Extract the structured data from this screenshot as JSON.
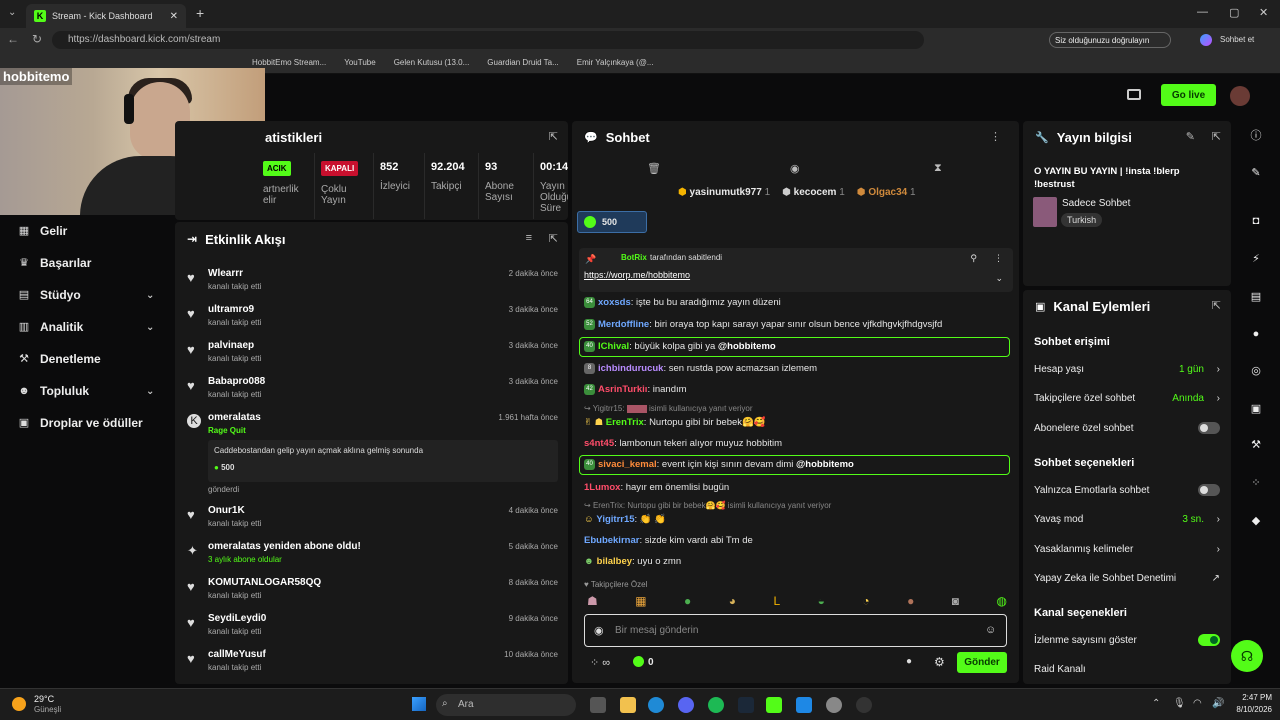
{
  "browser": {
    "tab_title": "Stream - Kick Dashboard",
    "url": "https://dashboard.kick.com/stream",
    "signin_notice": "Siz olduğunuzu doğrulayın",
    "copilot_label": "Sohbet et",
    "bookmarks": [
      "HobbitEmo Stream...",
      "YouTube",
      "Gelen Kutusu (13.0...",
      "Guardian Druid Ta...",
      "Emir Yalçınkaya (@..."
    ]
  },
  "webcam": {
    "overlay_text": "hobbitemo"
  },
  "topbar": {
    "go_live": "Go live"
  },
  "sidebar": {
    "items": [
      {
        "label": "Gelir",
        "icon": "revenue-icon"
      },
      {
        "label": "Başarılar",
        "icon": "trophy-icon"
      },
      {
        "label": "Stüdyo",
        "icon": "studio-icon",
        "expandable": true
      },
      {
        "label": "Analitik",
        "icon": "analytics-icon",
        "expandable": true
      },
      {
        "label": "Denetleme",
        "icon": "moderation-icon"
      },
      {
        "label": "Topluluk",
        "icon": "community-icon",
        "expandable": true
      },
      {
        "label": "Droplar ve ödüller",
        "icon": "drops-icon"
      }
    ]
  },
  "stats": {
    "title": "atistikleri",
    "cells": [
      {
        "value": "ACIK",
        "label": "artnerlik\nelir"
      },
      {
        "value": "KAPALI",
        "label": "Çoklu\nYayın"
      },
      {
        "value": "852",
        "label": "İzleyici"
      },
      {
        "value": "92.204",
        "label": "Takipçi"
      },
      {
        "value": "93",
        "label": "Abone\nSayısı"
      },
      {
        "value": "00:14:",
        "label": "Yayın\nOlduğu\nSüre"
      }
    ]
  },
  "activity": {
    "title": "Etkinlik Akışı",
    "items": [
      {
        "name": "Wlearrr",
        "sub": "kanalı takip etti",
        "time": "2 dakika önce"
      },
      {
        "name": "ultramro9",
        "sub": "kanalı takip etti",
        "time": "3 dakika önce"
      },
      {
        "name": "palvinaep",
        "sub": "kanalı takip etti",
        "time": "3 dakika önce"
      },
      {
        "name": "Babapro088",
        "sub": "kanalı takip etti",
        "time": "3 dakika önce"
      }
    ],
    "kicks": {
      "name": "omeralatas",
      "rage": "Rage Quit",
      "message": "Caddebostandan gelip yayın açmak aklına gelmiş sonunda",
      "amount": "500",
      "footer": "gönderdi",
      "time": "1.961 hafta önce"
    },
    "items2": [
      {
        "name": "Onur1K",
        "sub": "kanalı takip etti",
        "time": "4 dakika önce"
      },
      {
        "name": "omeralatas yeniden abone oldu!",
        "sub": "3 aylık abone oldular",
        "time": "5 dakika önce"
      },
      {
        "name": "KOMUTANLOGAR58QQ",
        "sub": "kanalı takip etti",
        "time": "8 dakika önce"
      },
      {
        "name": "SeydiLeydi0",
        "sub": "kanalı takip etti",
        "time": "9 dakika önce"
      },
      {
        "name": "callMeYusuf",
        "sub": "kanalı takip etti",
        "time": "10 dakika önce"
      }
    ]
  },
  "chat": {
    "title": "Sohbet",
    "top_gifters": [
      {
        "name": "yasinumutk977",
        "count": "1",
        "rank": "1"
      },
      {
        "name": "kecocem",
        "count": "1",
        "rank": "2"
      },
      {
        "name": "Olgac34",
        "count": "1",
        "rank": "3"
      }
    ],
    "kicks_amount": "500",
    "pinned": {
      "by": "BotRix",
      "by_suffix": "tarafından sabitlendi",
      "link": "https://worp.me/hobbitemo"
    },
    "messages": [
      {
        "badge": "64",
        "user": "xoxsds",
        "color": "#6fa8ff",
        "text": ": işte bu bu aradığımız yayın düzeni"
      },
      {
        "badge": "52",
        "user": "Merdoffline",
        "color": "#6fa8ff",
        "text": ": biri oraya top kapı sarayı yapar sınır olsun bence vjfkdhgvkjfhdgvsjfd"
      },
      {
        "badge": "40",
        "user": "IChival",
        "color": "#53fc18",
        "text": ": büyük kolpa gibi ya ",
        "mention": "@hobbitemo",
        "hl": true
      },
      {
        "badge": "8",
        "user": "ichbindurucuk",
        "color": "#b98cff",
        "text": ": sen rustda pow acmazsan izlemem"
      },
      {
        "badge": "42",
        "user": "AsrinTurkiı",
        "color": "#ff4d6a",
        "text": ": inandım"
      },
      {
        "reply": "Yigitrr15: ",
        "reply2": " isimli kullanıcıya yanıt veriyor"
      },
      {
        "badge": "",
        "user": "ErenTrix",
        "color": "#53fc18",
        "text": ": Nurtopu gibi bir bebek🤗🥰"
      },
      {
        "badge": "",
        "user": "s4nt45",
        "color": "#ff4d6a",
        "text": ": lambonun tekeri alıyor muyuz hobbitim"
      },
      {
        "badge": "40",
        "user": "sivaci_kemal",
        "color": "#ff8c3b",
        "text": ": event için kişi sınırı devam dimi ",
        "mention": "@hobbitemo",
        "hl": true
      },
      {
        "badge": "",
        "user": "1Lumox",
        "color": "#ff4d6a",
        "text": ": hayır em önemlisi bugün"
      },
      {
        "reply": "ErenTrix: Nurtopu gibi bir bebek🤗🥰",
        "reply2": " isimli kullanıcıya yanıt veriyor"
      },
      {
        "badge": "",
        "user": "Yigitrr15",
        "color": "#6fa8ff",
        "text": ": 👏 👏"
      },
      {
        "badge": "",
        "user": "Ebubekirnar",
        "color": "#6fa8ff",
        "text": ": sizde kim vardı abi Tm de"
      },
      {
        "badge": "",
        "user": "bilalbey",
        "color": "#ffd34d",
        "text": ": uyu o zmn"
      }
    ],
    "followers_only_label": "Takipçilere Özel",
    "input_placeholder": "Bir mesaj gönderin",
    "kicks_balance": "0",
    "send_label": "Gönder"
  },
  "info": {
    "title": "Yayın bilgisi",
    "stream_title": "O YAYIN BU YAYIN | !insta !blerp !bestrust",
    "category": "Sadece Sohbet",
    "language": "Turkish"
  },
  "actions": {
    "title": "Kanal Eylemleri",
    "chat_access": "Sohbet erişimi",
    "account_age_label": "Hesap yaşı",
    "account_age_value": "1 gün",
    "followers_only_label": "Takipçilere özel sohbet",
    "followers_only_value": "Anında",
    "subs_only_label": "Abonelere özel sohbet",
    "chat_options": "Sohbet seçenekleri",
    "emote_only_label": "Yalnızca Emotlarla sohbet",
    "slow_mode_label": "Yavaş mod",
    "slow_mode_value": "3 sn.",
    "banned_words_label": "Yasaklanmış kelimeler",
    "ai_mod_label": "Yapay Zeka ile Sohbet Denetimi",
    "channel_options": "Kanal seçenekleri",
    "viewcount_label": "İzlenme sayısını göster",
    "raid_label": "Raid Kanalı"
  },
  "taskbar": {
    "weather_temp": "29°C",
    "weather_desc": "Güneşli",
    "search": "Ara",
    "time": "2:47 PM",
    "date": "8/10/2026"
  },
  "colors": {
    "accent": "#53fc18",
    "panel": "#181818",
    "bg": "#0b0b0c"
  }
}
